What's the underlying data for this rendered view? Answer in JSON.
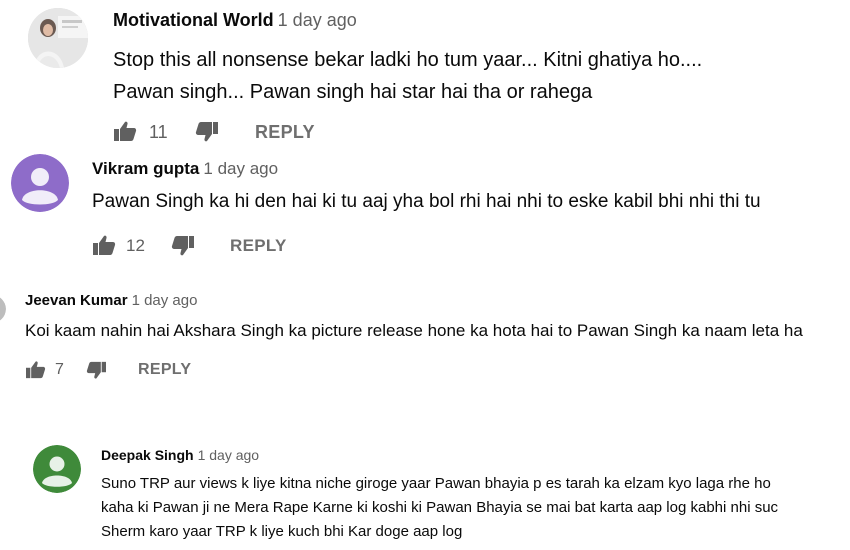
{
  "comments": [
    {
      "author": "Motivational World",
      "time": "1 day ago",
      "lines": [
        "Stop this all nonsense bekar ladki ho tum yaar... Kitni ghatiya ho....",
        "Pawan singh... Pawan singh hai star hai tha or rahega"
      ],
      "likes": "11",
      "reply": "REPLY",
      "avatar": "photo"
    },
    {
      "author": "Vikram gupta",
      "time": "1 day ago",
      "lines": [
        "Pawan Singh ka hi den hai ki tu aaj yha bol rhi hai nhi to eske kabil bhi nhi thi tu"
      ],
      "likes": "12",
      "reply": "REPLY",
      "avatar_color": "#8e6cc9"
    },
    {
      "author": "Jeevan Kumar",
      "time": "1 day ago",
      "lines": [
        "Koi kaam nahin hai Akshara Singh ka picture release hone ka hota hai to Pawan Singh ka naam leta ha"
      ],
      "likes": "7",
      "reply": "REPLY"
    },
    {
      "author": "Deepak Singh",
      "time": "1 day ago",
      "lines": [
        "Suno TRP aur views k liye kitna niche giroge yaar Pawan bhayia p es tarah ka elzam kyo laga rhe ho",
        "kaha ki Pawan ji ne Mera Rape Karne ki koshi ki Pawan Bhayia se mai bat karta aap log kabhi nhi suc",
        "Sherm karo yaar TRP k liye kuch bhi Kar doge aap log"
      ],
      "avatar_color": "#3f8a3a"
    }
  ]
}
